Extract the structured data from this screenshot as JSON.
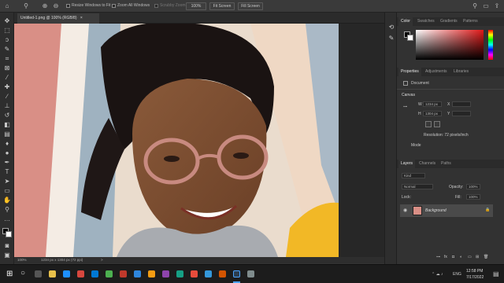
{
  "options_bar": {
    "resize_windows_label": "Resize Windows to Fit",
    "zoom_all_windows_label": "Zoom All Windows",
    "scrubby_zoom_label": "Scrubby Zoom",
    "zoom_percent_button": "100%",
    "fit_screen_button": "Fit Screen",
    "fill_screen_button": "Fill Screen"
  },
  "document": {
    "tab_title": "Untitled-1.png @ 100% (RGB/8)",
    "tab_close": "×"
  },
  "status": {
    "zoom": "100%",
    "dimensions": "1234 px x 1304 px (72 ppi)",
    "arrow": ">"
  },
  "color_panel": {
    "tabs": [
      "Color",
      "Swatches",
      "Gradients",
      "Patterns"
    ],
    "hue_color": "#e01818"
  },
  "properties_panel": {
    "tabs": [
      "Properties",
      "Adjustments",
      "Libraries"
    ],
    "doc_label": "Document",
    "canvas_header": "Canvas",
    "w_label": "W",
    "w_value": "1234 px",
    "h_label": "H",
    "h_value": "1304 px",
    "x_label": "X",
    "y_label": "Y",
    "resolution": "Resolution: 72 pixels/inch",
    "mode_label": "Mode"
  },
  "layers_panel": {
    "tabs": [
      "Layers",
      "Channels",
      "Paths"
    ],
    "kind_filter": "Kind",
    "blend_mode": "Normal",
    "opacity_label": "Opacity:",
    "opacity_value": "100%",
    "lock_label": "Lock:",
    "fill_label": "Fill:",
    "fill_value": "100%",
    "layer_name": "Background"
  },
  "taskbar": {
    "time": "12:58 PM",
    "date": "7/17/2022",
    "lang": "ENG"
  }
}
